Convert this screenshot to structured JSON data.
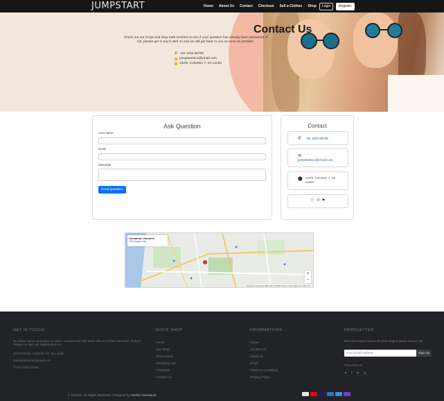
{
  "nav": {
    "brand": "JUMPSTART",
    "links": [
      "Home",
      "About Us",
      "Contact",
      "Checkout",
      "Sell a Clothes",
      "Shop"
    ],
    "login": "Login",
    "register": "Register"
  },
  "hero": {
    "title": "Contact Us",
    "intro": "Check out our FAQs and Stay Safe sections to see if your question has already been answered. If not, please get in touch with us and we will get back to you as soon as possible.",
    "phone": "+94 1234 56789",
    "email": "jumpstartsco@email.com",
    "address": "120/5, Colombo 7, Sri Lanka"
  },
  "ask": {
    "heading": "Ask Question",
    "name_label": "Your name",
    "email_label": "Email",
    "message_label": "Message",
    "submit": "Send Question"
  },
  "contact": {
    "heading": "Contact",
    "phone": "+94 1234 56789",
    "email": "jumpstartsco@email.com",
    "address": "120/5, Colombo 7, Sri Lanka"
  },
  "map": {
    "place": "Cinnamon Gardens",
    "view_link": "View larger map",
    "attribution": "Keyboard shortcuts  Map data ©2022  Terms of Use  Report a map error"
  },
  "footer": {
    "get_in_touch": {
      "heading": "GET IN TOUCH",
      "text": "No dolore ipsum accusam no lorem. Invidunt sed clita kasd clita et et dolor sed dolor. Rebum tempor no vero est magna amet no",
      "address": "123 Street, Colombo 07, Sri Lanka",
      "email": "jumpstartsco@gmail.com",
      "phone": "+94 7845 12345"
    },
    "quick_shop": {
      "heading": "QUICK SHOP",
      "items": [
        "Home",
        "Our Shop",
        "Shop Detail",
        "Shopping Cart",
        "Checkout",
        "Contact Us"
      ]
    },
    "informations": {
      "heading": "INFORMATIONS",
      "items": [
        "Home",
        "Contact Us",
        "About Us",
        "FAQs",
        "Teams & Conditions",
        "Privacy Policy"
      ]
    },
    "newsletter": {
      "heading": "NEWSLETTER",
      "text": "Duo stet tempor ipsum sit amet magna ipsum tempor est",
      "placeholder": "Your Email Address",
      "button": "Sign Up",
      "follow": "FOLLOW US"
    },
    "copyright": "© Domain. All Rights Reserved. Designed by",
    "designer": "Hashini Sewwandi"
  }
}
